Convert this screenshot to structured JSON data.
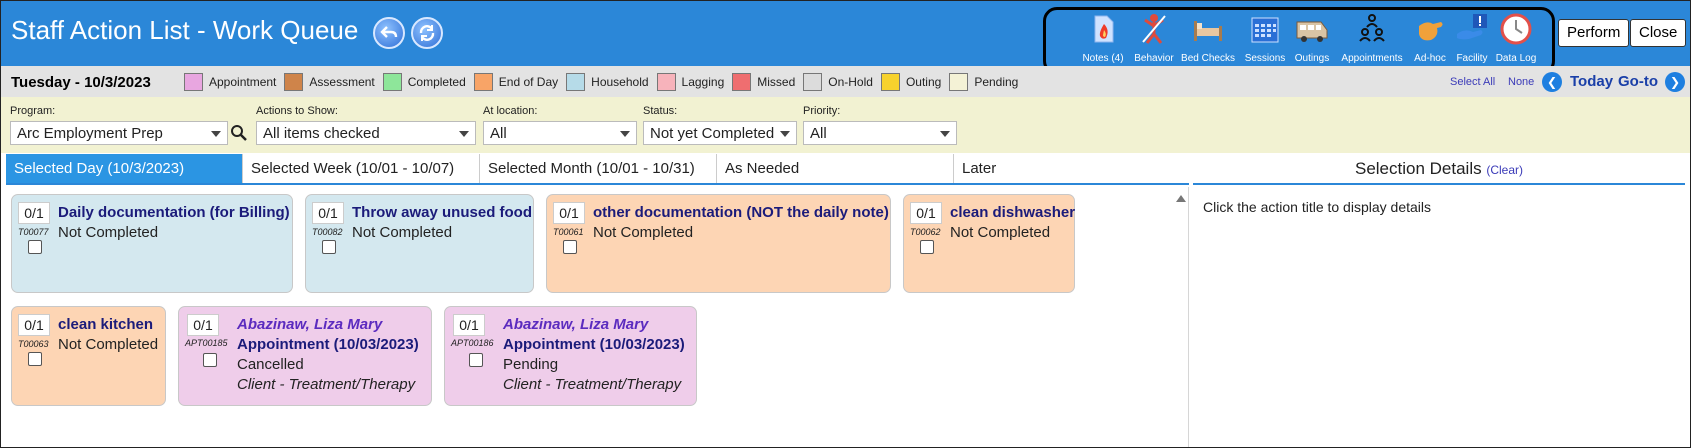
{
  "header": {
    "title": "Staff Action List - Work Queue",
    "tools": [
      {
        "label": "Notes (4)",
        "icon": "notes-icon"
      },
      {
        "label": "Behavior",
        "icon": "behavior-icon"
      },
      {
        "label": "Bed Checks",
        "icon": "bed-icon"
      },
      {
        "label": "Sessions",
        "icon": "calendar-icon"
      },
      {
        "label": "Outings",
        "icon": "van-icon"
      },
      {
        "label": "Appointments",
        "icon": "people-icon"
      },
      {
        "label": "Ad-hoc",
        "icon": "hand-icon"
      },
      {
        "label": "Facility",
        "icon": "facility-icon"
      },
      {
        "label": "Data Log",
        "icon": "clock-icon"
      }
    ],
    "perform_label": "Perform",
    "close_label": "Close"
  },
  "legend_bar": {
    "date": "Tuesday - 10/3/2023",
    "legend": [
      {
        "label": "Appointment",
        "color": "#e8a6e0"
      },
      {
        "label": "Assessment",
        "color": "#cf844a"
      },
      {
        "label": "Completed",
        "color": "#8ee69a"
      },
      {
        "label": "End of Day",
        "color": "#f8a467"
      },
      {
        "label": "Household",
        "color": "#b6dbe8"
      },
      {
        "label": "Lagging",
        "color": "#f7b3bb"
      },
      {
        "label": "Missed",
        "color": "#ef6e70"
      },
      {
        "label": "On-Hold",
        "color": "#dcdcdc"
      },
      {
        "label": "Outing",
        "color": "#f7d22d"
      },
      {
        "label": "Pending",
        "color": "#f4f2d6"
      }
    ],
    "select_all": "Select All",
    "none": "None",
    "today": "Today",
    "goto": "Go-to"
  },
  "filters": {
    "program": {
      "label": "Program:",
      "value": "Arc Employment Prep"
    },
    "actions": {
      "label": "Actions to Show:",
      "value": "All items checked"
    },
    "location": {
      "label": "At location:",
      "value": "All"
    },
    "status": {
      "label": "Status:",
      "value": "Not yet Completed"
    },
    "priority": {
      "label": "Priority:",
      "value": "All"
    }
  },
  "tabs": [
    "Selected Day (10/3/2023)",
    "Selected Week (10/01 - 10/07)",
    "Selected Month (10/01 - 10/31)",
    "As Needed",
    "Later"
  ],
  "details": {
    "title": "Selection Details",
    "clear": "(Clear)",
    "hint": "Click the action title to display details"
  },
  "cards": [
    {
      "count": "0/1",
      "code": "T00077",
      "title": "Daily documentation (for Billing)",
      "status": "Not Completed"
    },
    {
      "count": "0/1",
      "code": "T00082",
      "title": "Throw away unused food",
      "status": "Not Completed"
    },
    {
      "count": "0/1",
      "code": "T00061",
      "title": "other documentation (NOT the daily note)",
      "status": "Not Completed"
    },
    {
      "count": "0/1",
      "code": "T00062",
      "title": "clean dishwasher",
      "status": "Not Completed"
    },
    {
      "count": "0/1",
      "code": "T00063",
      "title": "clean kitchen",
      "status": "Not Completed"
    },
    {
      "count": "0/1",
      "code": "APT00185",
      "name": "Abazinaw, Liza Mary",
      "title": "Appointment (10/03/2023)",
      "status": "Cancelled",
      "type": "Client - Treatment/Therapy"
    },
    {
      "count": "0/1",
      "code": "APT00186",
      "name": "Abazinaw, Liza Mary",
      "title": "Appointment (10/03/2023)",
      "status": "Pending",
      "type": "Client - Treatment/Therapy"
    }
  ]
}
